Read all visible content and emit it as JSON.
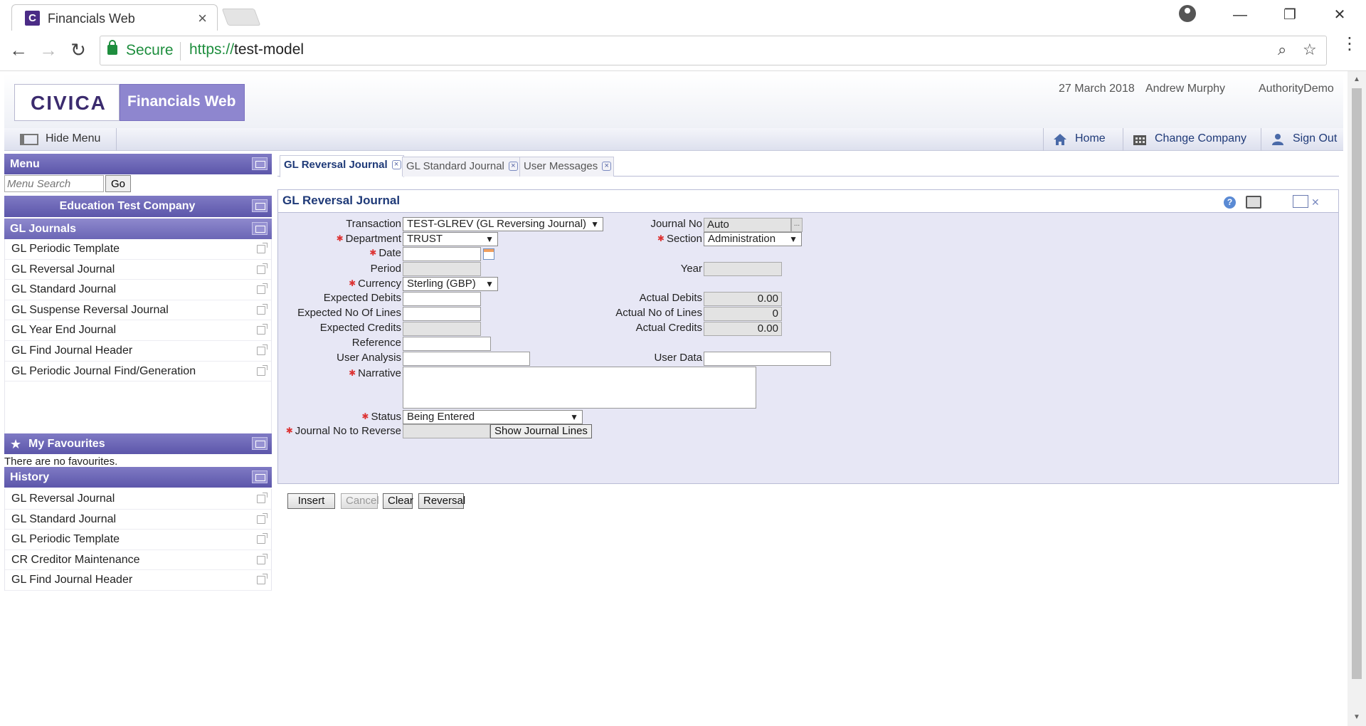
{
  "browser": {
    "tab_title": "Financials Web",
    "favicon_letter": "C",
    "secure_label": "Secure",
    "url_scheme": "https://",
    "url_host": "test-model"
  },
  "header": {
    "logo_text": "CIVICA",
    "brand": "Financials Web",
    "date": "27 March 2018",
    "user": "Andrew Murphy",
    "authority": "AuthorityDemo"
  },
  "toolbar": {
    "hide_menu": "Hide Menu",
    "home": "Home",
    "change_company": "Change Company",
    "sign_out": "Sign Out"
  },
  "sidebar": {
    "menu_title": "Menu",
    "search_placeholder": "Menu Search",
    "go_label": "Go",
    "company": "Education Test Company",
    "group": "GL Journals",
    "items": [
      "GL Periodic Template",
      "GL Reversal Journal",
      "GL Standard Journal",
      "GL Suspense Reversal Journal",
      "GL Year End Journal",
      "GL Find Journal Header",
      "GL Periodic Journal Find/Generation"
    ],
    "favourites_title": "My Favourites",
    "favourites_empty": "There are no favourites.",
    "history_title": "History",
    "history": [
      "GL Reversal Journal",
      "GL Standard Journal",
      "GL Periodic Template",
      "CR Creditor Maintenance",
      "GL Find Journal Header"
    ]
  },
  "tabs": [
    {
      "label": "GL Reversal Journal",
      "active": true
    },
    {
      "label": "GL Standard Journal",
      "active": false
    },
    {
      "label": "User Messages",
      "active": false
    }
  ],
  "form": {
    "title": "GL Reversal Journal",
    "labels": {
      "transaction": "Transaction",
      "department": "Department",
      "date": "Date",
      "period": "Period",
      "currency": "Currency",
      "expected_debits": "Expected Debits",
      "expected_lines": "Expected No Of Lines",
      "expected_credits": "Expected Credits",
      "reference": "Reference",
      "user_analysis": "User Analysis",
      "narrative": "Narrative",
      "status": "Status",
      "journal_to_reverse": "Journal No to Reverse",
      "journal_no": "Journal No",
      "section": "Section",
      "year": "Year",
      "actual_debits": "Actual Debits",
      "actual_lines": "Actual No of Lines",
      "actual_credits": "Actual Credits",
      "user_data": "User Data"
    },
    "values": {
      "transaction": "TEST-GLREV (GL Reversing Journal)",
      "department": "TRUST",
      "date": "",
      "period": "",
      "currency": "Sterling (GBP)",
      "expected_debits": "",
      "expected_lines": "",
      "expected_credits": "",
      "reference": "",
      "user_analysis": "",
      "narrative": "",
      "status": "Being Entered",
      "journal_to_reverse": "",
      "journal_no": "Auto",
      "section": "Administration",
      "year": "",
      "actual_debits": "0.00",
      "actual_lines": "0",
      "actual_credits": "0.00",
      "user_data": ""
    },
    "show_lines_label": "Show Journal Lines",
    "lookup_label": "..."
  },
  "actions": {
    "insert": "Insert",
    "cancel": "Cancel",
    "clear": "Clear",
    "reversal": "Reversal"
  }
}
